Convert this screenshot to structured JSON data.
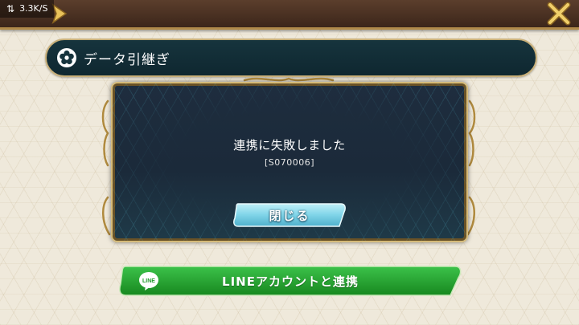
{
  "status": {
    "speed": "3.3K/S",
    "icon": "network-swap-icon"
  },
  "topbar": {
    "back_icon": "back-arrow-icon",
    "close_icon": "close-x-icon"
  },
  "header": {
    "title": "データ引継ぎ",
    "icon": "flower-icon"
  },
  "dialog": {
    "message": "連携に失敗しました",
    "code": "[S070006]",
    "close_label": "閉じる"
  },
  "line_button": {
    "label": "LINEアカウントと連携",
    "logo_text": "LINE"
  },
  "colors": {
    "topbar": "#4a3020",
    "gold": "#c9a25a",
    "dialog_bg": "#1e2d3e",
    "header_bg": "#16343d",
    "line_green": "#1e9a2a",
    "close_button": "#7fd4e8"
  }
}
